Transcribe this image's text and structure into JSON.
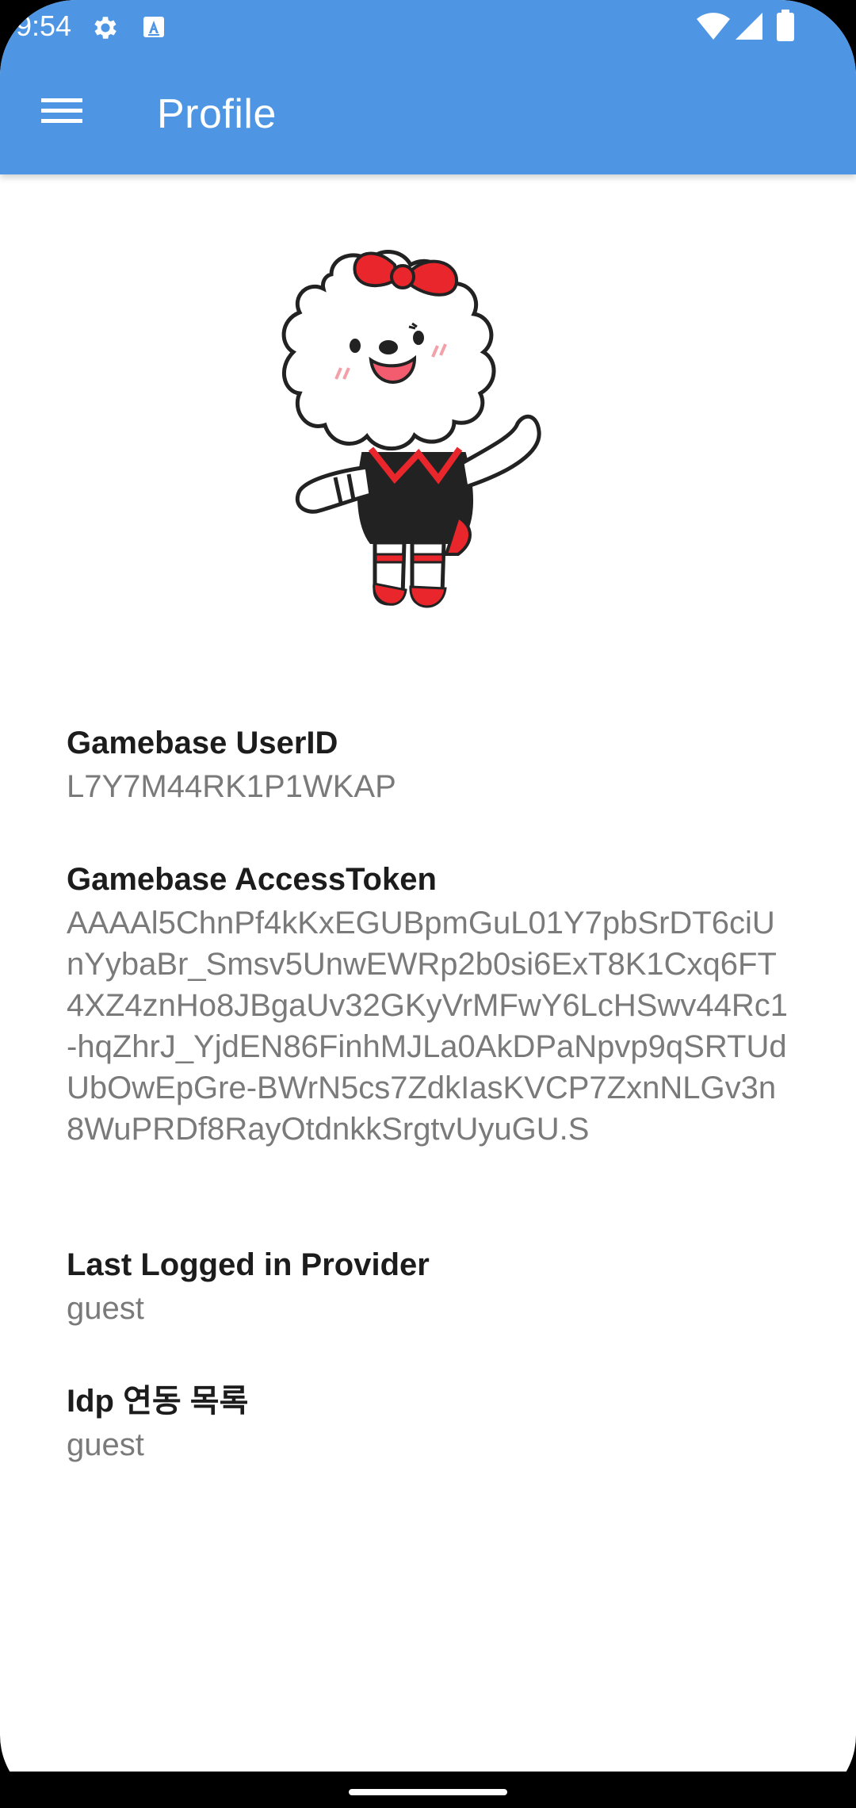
{
  "status_bar": {
    "time": "9:54",
    "icons": [
      "gear-icon",
      "a-badge-icon",
      "wifi-icon",
      "signal-icon",
      "battery-icon"
    ]
  },
  "app_bar": {
    "title": "Profile",
    "menu_icon": "hamburger-menu-icon",
    "background_color": "#4e96e4"
  },
  "profile": {
    "avatar": "mascot-dog-with-red-bow",
    "fields": [
      {
        "label": "Gamebase UserID",
        "value": "L7Y7M44RK1P1WKAP"
      },
      {
        "label": "Gamebase AccessToken",
        "value": "AAAAl5ChnPf4kKxEGUBpmGuL01Y7pbSrDT6ciUnYybaBr_Smsv5UnwEWRp2b0si6ExT8K1Cxq6FT4XZ4znHo8JBgaUv32GKyVrMFwY6LcHSwv44Rc1-hqZhrJ_YjdEN86FinhMJLa0AkDPaNpvp9qSRTUdUbOwEpGre-BWrN5cs7ZdkIasKVCP7ZxnNLGv3n8WuPRDf8RayOtdnkkSrgtvUyuGU.S"
      },
      {
        "label": "Last Logged in Provider",
        "value": "guest"
      },
      {
        "label": "Idp 연동 목록",
        "value": "guest"
      }
    ]
  }
}
